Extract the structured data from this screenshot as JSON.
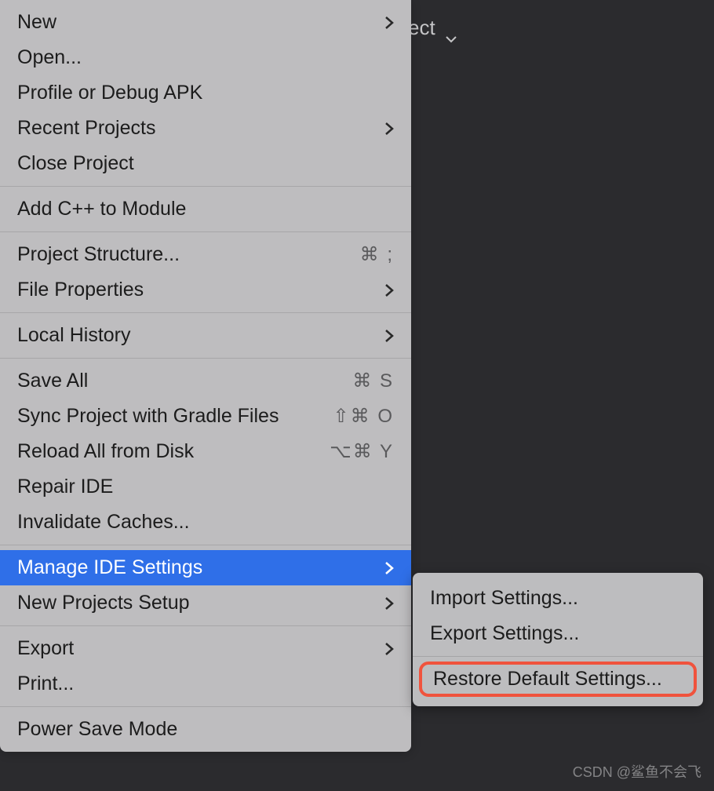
{
  "toolbar": {
    "partial_text": "ect"
  },
  "menu": {
    "items": [
      {
        "label": "New",
        "submenu": true
      },
      {
        "label": "Open..."
      },
      {
        "label": "Profile or Debug APK"
      },
      {
        "label": "Recent Projects",
        "submenu": true
      },
      {
        "label": "Close Project"
      }
    ],
    "group2": [
      {
        "label": "Add C++ to Module"
      }
    ],
    "group3": [
      {
        "label": "Project Structure...",
        "shortcut": "⌘ ;"
      },
      {
        "label": "File Properties",
        "submenu": true
      }
    ],
    "group4": [
      {
        "label": "Local History",
        "submenu": true
      }
    ],
    "group5": [
      {
        "label": "Save All",
        "shortcut": "⌘ S"
      },
      {
        "label": "Sync Project with Gradle Files",
        "shortcut": "⇧⌘ O"
      },
      {
        "label": "Reload All from Disk",
        "shortcut": "⌥⌘ Y"
      },
      {
        "label": "Repair IDE"
      },
      {
        "label": "Invalidate Caches..."
      }
    ],
    "group6": [
      {
        "label": "Manage IDE Settings",
        "submenu": true,
        "highlighted": true
      },
      {
        "label": "New Projects Setup",
        "submenu": true
      }
    ],
    "group7": [
      {
        "label": "Export",
        "submenu": true
      },
      {
        "label": "Print..."
      }
    ],
    "group8": [
      {
        "label": "Power Save Mode"
      }
    ]
  },
  "submenu": {
    "items1": [
      {
        "label": "Import Settings..."
      },
      {
        "label": "Export Settings..."
      }
    ],
    "items2": [
      {
        "label": "Restore Default Settings...",
        "highlighted_box": true
      }
    ]
  },
  "watermark": "CSDN @鲨鱼不会飞"
}
